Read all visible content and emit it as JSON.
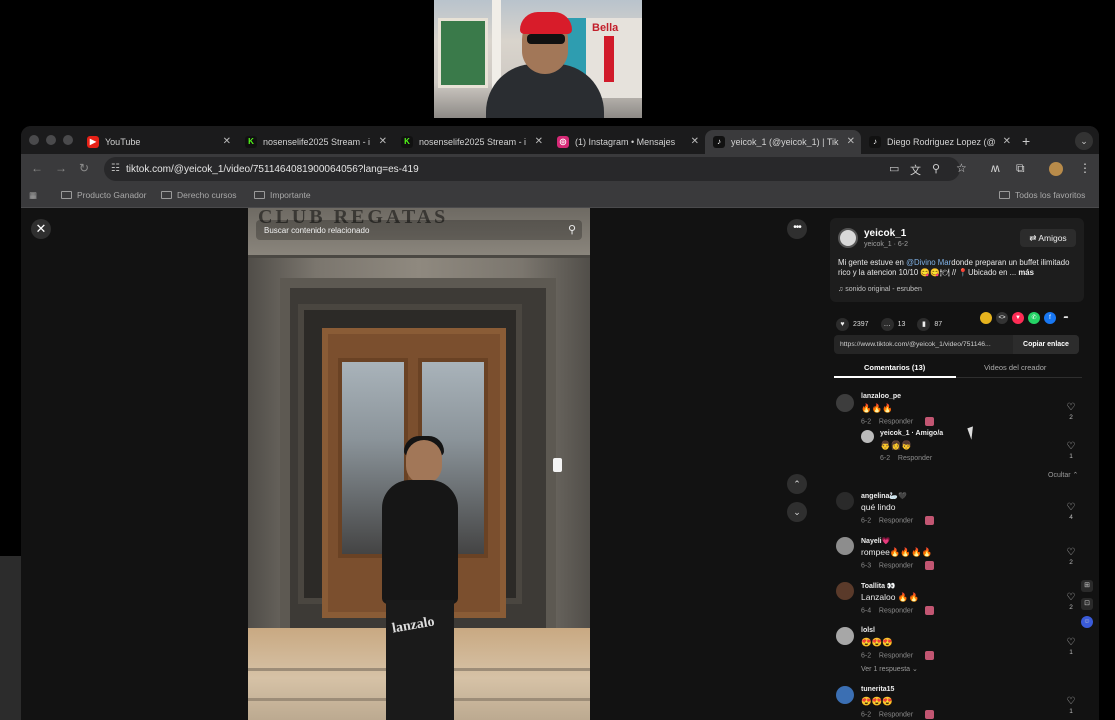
{
  "browser": {
    "tabs": [
      {
        "label": "YouTube",
        "favicon": "youtube-icon",
        "color": "#e62117",
        "glyph": "▶",
        "active": false
      },
      {
        "label": "nosenselife2025 Stream - і",
        "favicon": "kick-icon",
        "color": "#53fc18",
        "glyph": "K",
        "active": false
      },
      {
        "label": "nosenselife2025 Stream - і",
        "favicon": "kick-icon",
        "color": "#53fc18",
        "glyph": "K",
        "active": false
      },
      {
        "label": "(1) Instagram • Mensajes",
        "favicon": "instagram-icon",
        "color": "#d62976",
        "glyph": "◎",
        "active": false
      },
      {
        "label": "yeicok_1 (@yeicok_1) | Tik",
        "favicon": "tiktok-icon",
        "color": "#111111",
        "glyph": "♪",
        "active": true
      },
      {
        "label": "Diego Rodriguez Lopez (@",
        "favicon": "tiktok-icon",
        "color": "#111111",
        "glyph": "♪",
        "active": false
      }
    ],
    "url": "tiktok.com/@yeicok_1/video/7511464081900064056?lang=es-419",
    "bookmarks": [
      "Producto Ganador",
      "Derecho cursos",
      "Importante"
    ],
    "bookmarks_right": "Todos los favoritos"
  },
  "video": {
    "search_text": "Buscar contenido relacionado",
    "sign_text": "CLUB REGATAS"
  },
  "post": {
    "username": "yeicok_1",
    "handle_date": "yeicok_1 · 6-2",
    "friends_label": "⇄ Amigos",
    "description_pre": "Mi gente estuve en ",
    "description_tag": "@Divino Mar",
    "description_post": "donde preparan un buffet ilimitado rico y la atencion 10/10 😋😋🍽 // 📍Ubicado en ...",
    "description_more": "más",
    "sound": "sonido original - esruben",
    "likes": "2397",
    "comments_count": "13",
    "saves": "87",
    "link": "https://www.tiktok.com/@yeicok_1/video/751146...",
    "copy_label": "Copiar enlace",
    "tab_comments": "Comentarios (13)",
    "tab_creator": "Videos del creador"
  },
  "comments": [
    {
      "name": "lanzaloo_pe",
      "text": "🔥🔥🔥",
      "meta": "6-2",
      "reply": "Responder",
      "likes": "2"
    },
    {
      "name": "yeicok_1 · Amigo/a",
      "text": "👨‍👩👦",
      "meta": "6-2",
      "reply": "Responder",
      "likes": "1"
    },
    {
      "name": "angelina🦢🖤",
      "text": "qué lindo",
      "meta": "6-2",
      "reply": "Responder",
      "likes": "4"
    },
    {
      "name": "Nayeli💗",
      "text": "rompee🔥🔥🔥🔥",
      "meta": "6-3",
      "reply": "Responder",
      "likes": "2"
    },
    {
      "name": "Toallita 👀",
      "text": "Lanzaloo 🔥🔥",
      "meta": "6-4",
      "reply": "Responder",
      "likes": "2"
    },
    {
      "name": "lolsl",
      "text": "😍😍😍",
      "meta": "6-2",
      "reply": "Responder",
      "likes": "1"
    },
    {
      "name": "tunerita15",
      "text": "😍😍😍",
      "meta": "6-2",
      "reply": "Responder",
      "likes": "1"
    }
  ],
  "hide_label": "Ocultar ⌃",
  "view_replies": "Ver 1 respuesta ⌄",
  "colors": {
    "accent": "#fe2c55",
    "link": "#7fb1e6"
  }
}
